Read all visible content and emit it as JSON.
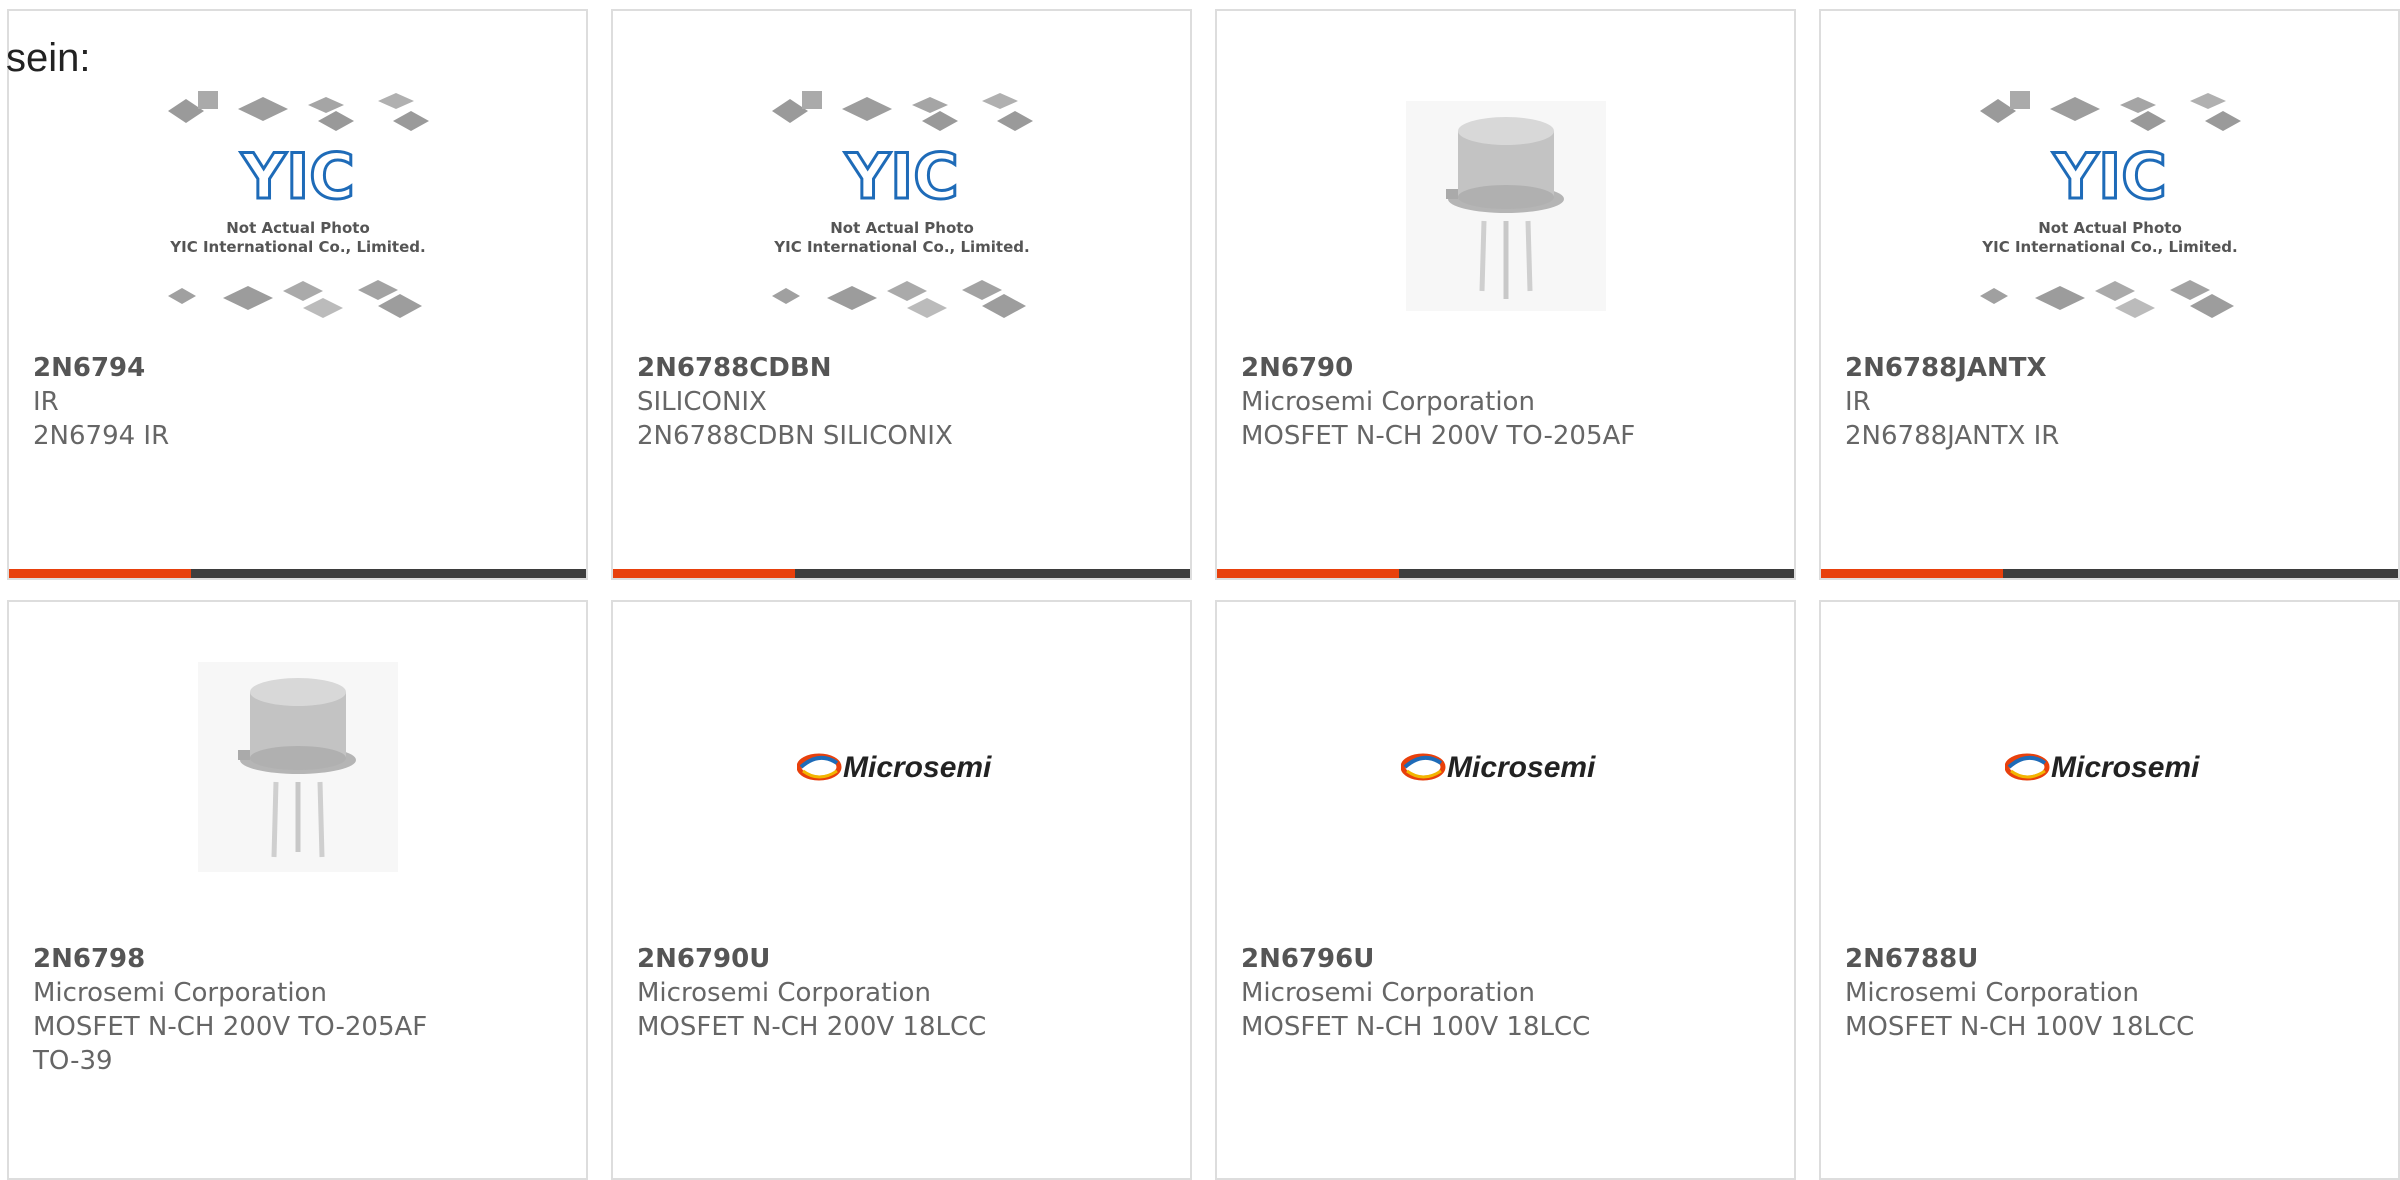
{
  "prefix_text": "sein:",
  "placeholder_caption": {
    "line1": "Not Actual Photo",
    "line2": "YIC International Co., Limited.",
    "logo": "YIC"
  },
  "microsemi_logo_text": "Microsemi",
  "products": [
    {
      "part": "2N6794",
      "maker": "IR",
      "desc": "2N6794 IR",
      "image": "placeholder"
    },
    {
      "part": "2N6788CDBN",
      "maker": "SILICONIX",
      "desc": "2N6788CDBN SILICONIX",
      "image": "placeholder"
    },
    {
      "part": "2N6790",
      "maker": "Microsemi Corporation",
      "desc": "MOSFET N-CH 200V TO-205AF",
      "image": "to-can"
    },
    {
      "part": "2N6788JANTX",
      "maker": "IR",
      "desc": "2N6788JANTX IR",
      "image": "placeholder"
    },
    {
      "part": "2N6798",
      "maker": "Microsemi Corporation",
      "desc": "MOSFET N-CH 200V TO-205AF",
      "desc2": "TO-39",
      "image": "to-can"
    },
    {
      "part": "2N6790U",
      "maker": "Microsemi Corporation",
      "desc": "MOSFET N-CH 200V 18LCC",
      "image": "microsemi-logo"
    },
    {
      "part": "2N6796U",
      "maker": "Microsemi Corporation",
      "desc": "MOSFET N-CH 100V 18LCC",
      "image": "microsemi-logo"
    },
    {
      "part": "2N6788U",
      "maker": "Microsemi Corporation",
      "desc": "MOSFET N-CH 100V 18LCC",
      "image": "microsemi-logo"
    }
  ],
  "colors": {
    "accent": "#e8400c",
    "bar_dark": "#3d3d3d",
    "border": "#dddddd",
    "yic_blue": "#1e6bb8"
  }
}
